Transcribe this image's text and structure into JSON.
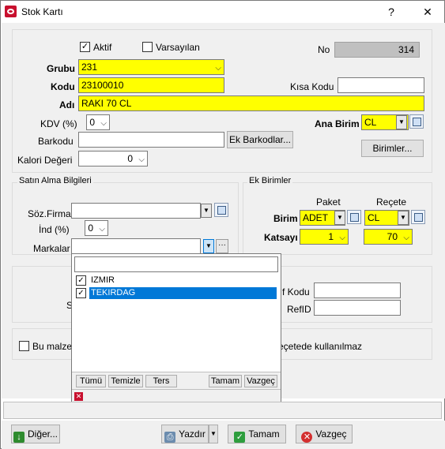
{
  "window": {
    "title": "Stok Kartı",
    "help": "?",
    "close": "✕"
  },
  "top": {
    "aktif_label": "Aktif",
    "aktif_checked": true,
    "varsayilan_label": "Varsayılan",
    "varsayilan_checked": false,
    "no_label": "No",
    "no_value": "314",
    "grubu_label": "Grubu",
    "grubu_value": "231",
    "kodu_label": "Kodu",
    "kodu_value": "23100010",
    "kisa_kodu_label": "Kısa Kodu",
    "kisa_kodu_value": "",
    "adi_label": "Adı",
    "adi_value": "RAKI 70 CL",
    "kdv_label": "KDV (%)",
    "kdv_value": "0",
    "ana_birim_label": "Ana Birim",
    "ana_birim_value": "CL",
    "barkodu_label": "Barkodu",
    "barkodu_value": "",
    "ek_barkodlar_button": "Ek Barkodlar...",
    "birimler_button": "Birimler...",
    "kalori_label": "Kalori Değeri",
    "kalori_value": "0"
  },
  "satin_alma": {
    "title": "Satın Alma Bilgileri",
    "soz_firma_label": "Söz.Firma",
    "soz_firma_value": "",
    "ind_label": "İnd (%)",
    "ind_value": "0",
    "markalar_label": "Markalar",
    "markalar_value": ""
  },
  "ek_birimler": {
    "title": "Ek Birimler",
    "paket_header": "Paket",
    "recete_header": "Reçete",
    "birim_label": "Birim",
    "katsayi_label": "Katsayı",
    "paket_birim": "ADET",
    "recete_birim": "CL",
    "paket_katsayi": "1",
    "recete_katsayi": "70"
  },
  "hidden_section": {
    "kodu_label_partial": "f Kodu",
    "kodu_value": "",
    "refid_label": "RefID",
    "refid_value": "",
    "s_label_partial": "S"
  },
  "bottom_checkbox": {
    "left_text": "Bu malze",
    "right_text": "eçetede kullanılmaz",
    "checked": false
  },
  "markalar_popup": {
    "search_value": "",
    "items": [
      {
        "label": "IZMIR",
        "checked": true,
        "selected": false
      },
      {
        "label": "TEKIRDAG",
        "checked": true,
        "selected": true
      }
    ],
    "buttons": [
      "Tümü",
      "Temizle",
      "Ters",
      "Tamam",
      "Vazgeç"
    ]
  },
  "footer_buttons": {
    "diger": "Diğer...",
    "yazdir": "Yazdır",
    "tamam": "Tamam",
    "vazgec": "Vazgeç"
  },
  "colors": {
    "required_field": "#ffff00",
    "selection": "#0078d7",
    "readonly_field": "#c0c0c0"
  }
}
